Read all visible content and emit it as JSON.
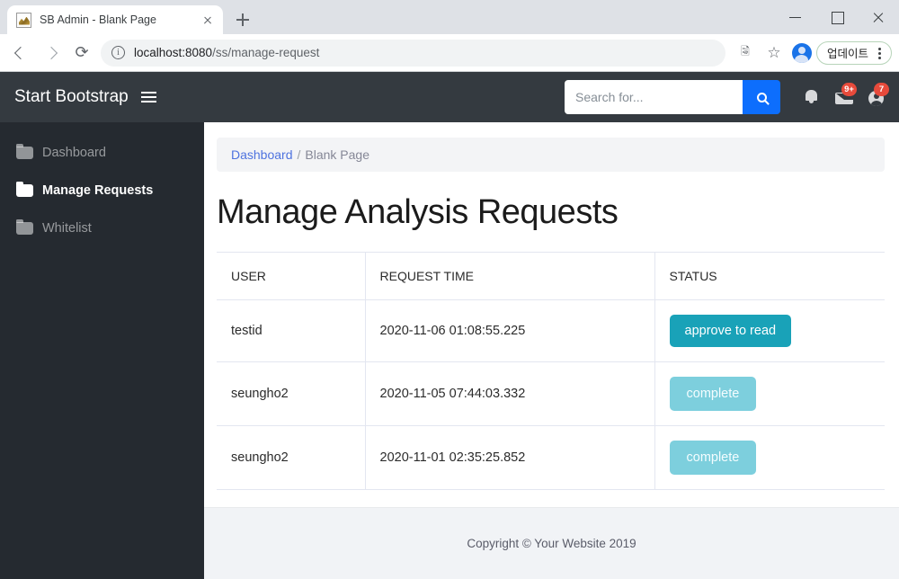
{
  "browser": {
    "tab": {
      "title": "SB Admin - Blank Page",
      "favicon_icon": "site-favicon"
    },
    "new_tab_icon": "plus-icon",
    "close_tab_icon": "close-icon",
    "back_icon": "arrow-left-icon",
    "forward_icon": "arrow-right-icon",
    "reload_icon": "reload-icon",
    "site_info_icon": "info-icon",
    "url": {
      "host": "localhost:8080",
      "path": "/ss/manage-request"
    },
    "translate_icon": "translate-icon",
    "bookmark_icon": "star-icon",
    "profile_icon": "profile-avatar-icon",
    "update_label": "업데이트",
    "menu_icon": "kebab-menu-icon",
    "window": {
      "minimize_icon": "minimize-icon",
      "maximize_icon": "maximize-icon",
      "close_icon": "window-close-icon"
    }
  },
  "topnav": {
    "brand": "Start Bootstrap",
    "hamburger_icon": "hamburger-menu-icon",
    "search": {
      "placeholder": "Search for...",
      "value": "",
      "button_icon": "search-icon"
    },
    "icons": [
      {
        "name": "alerts-bell-icon",
        "badge": ""
      },
      {
        "name": "messages-envelope-icon",
        "badge": "9+"
      },
      {
        "name": "user-profile-icon",
        "badge": "7"
      }
    ]
  },
  "sidebar": {
    "items": [
      {
        "label": "Dashboard",
        "icon": "folder-icon",
        "active": false
      },
      {
        "label": "Manage Requests",
        "icon": "folder-icon",
        "active": true
      },
      {
        "label": "Whitelist",
        "icon": "folder-icon",
        "active": false
      }
    ]
  },
  "main": {
    "breadcrumb": {
      "root": "Dashboard",
      "separator": "/",
      "current": "Blank Page"
    },
    "title": "Manage Analysis Requests",
    "table": {
      "columns": [
        "USER",
        "REQUEST TIME",
        "STATUS"
      ],
      "rows": [
        {
          "user": "testid",
          "request_time": "2020-11-06 01:08:55.225",
          "status_label": "approve to read",
          "status_state": "actionable"
        },
        {
          "user": "seungho2",
          "request_time": "2020-11-05 07:44:03.332",
          "status_label": "complete",
          "status_state": "done"
        },
        {
          "user": "seungho2",
          "request_time": "2020-11-01 02:35:25.852",
          "status_label": "complete",
          "status_state": "done"
        }
      ]
    }
  },
  "footer": {
    "copyright": "Copyright © Your Website 2019"
  },
  "colors": {
    "navbar_dark": "#343a40",
    "sidebar_dark": "#252a30",
    "search_button_blue": "#0d6efd",
    "breadcrumb_link_blue": "#4e73df",
    "status_info_teal": "#19a2b8",
    "status_disabled_teal": "#7dcfdd",
    "badge_red": "#e74a3b"
  }
}
